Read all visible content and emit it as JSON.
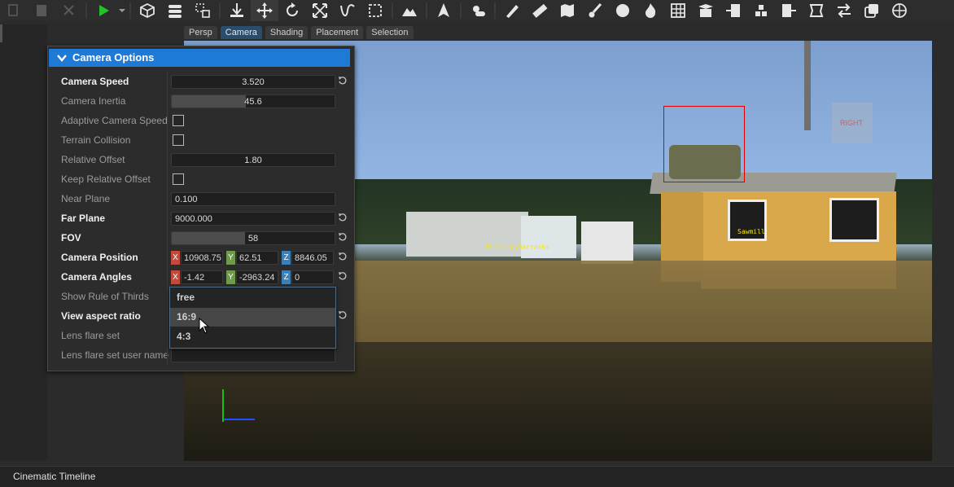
{
  "toolbar": {
    "buttons": [
      "copy-icon",
      "paste-icon",
      "cut-icon",
      "play-icon",
      "cube-icon",
      "layers-icon",
      "select-icon",
      "snap-icon",
      "move-icon",
      "rotate-icon",
      "scale-icon",
      "curve-icon",
      "marquee-icon",
      "terrain-icon",
      "navmesh-icon",
      "weather-icon",
      "pencil-icon",
      "ruler-icon",
      "map-icon",
      "paint-brush-icon",
      "circle-icon",
      "fire-icon",
      "grid-icon",
      "box-open-icon",
      "import-icon",
      "stack-icon",
      "export-icon",
      "polygon-icon",
      "swap-icon",
      "copy-window-icon",
      "globe-icon"
    ]
  },
  "viewport_tabs": [
    {
      "label": "Persp"
    },
    {
      "label": "Camera"
    },
    {
      "label": "Shading"
    },
    {
      "label": "Placement"
    },
    {
      "label": "Selection"
    }
  ],
  "camera_panel": {
    "title": "Camera Options",
    "rows": {
      "camera_speed": {
        "label": "Camera Speed",
        "value": "3.520"
      },
      "camera_inertia": {
        "label": "Camera Inertia",
        "value": "45.6",
        "fill": 0.456
      },
      "adaptive_speed": {
        "label": "Adaptive Camera Speed"
      },
      "terrain_collision": {
        "label": "Terrain Collision"
      },
      "relative_offset": {
        "label": "Relative Offset",
        "value": "1.80"
      },
      "keep_relative_offset": {
        "label": "Keep Relative Offset"
      },
      "near_plane": {
        "label": "Near Plane",
        "value": "0.100"
      },
      "far_plane": {
        "label": "Far Plane",
        "value": "9000.000"
      },
      "fov": {
        "label": "FOV",
        "value": "58",
        "fill": 0.45
      },
      "camera_position": {
        "label": "Camera Position",
        "x": "10908.75",
        "y": "62.51",
        "z": "8846.05"
      },
      "camera_angles": {
        "label": "Camera Angles",
        "x": "-1.42",
        "y": "-2963.24",
        "z": "0"
      },
      "rule_of_thirds": {
        "label": "Show Rule of Thirds"
      },
      "aspect_ratio": {
        "label": "View aspect ratio"
      },
      "lens_flare_set": {
        "label": "Lens flare set"
      },
      "lens_flare_user": {
        "label": "Lens flare set user name"
      }
    },
    "axis_labels": {
      "x": "X",
      "y": "Y",
      "z": "Z"
    },
    "aspect_options": [
      "free",
      "16:9",
      "4:3"
    ],
    "aspect_hovered": "16:9"
  },
  "viewport": {
    "label_barracks": "MilitaryBarracks",
    "label_sawmill": "Sawmill",
    "gizmo_label": "RIGHT"
  },
  "bottom_panel": {
    "title": "Cinematic Timeline"
  }
}
